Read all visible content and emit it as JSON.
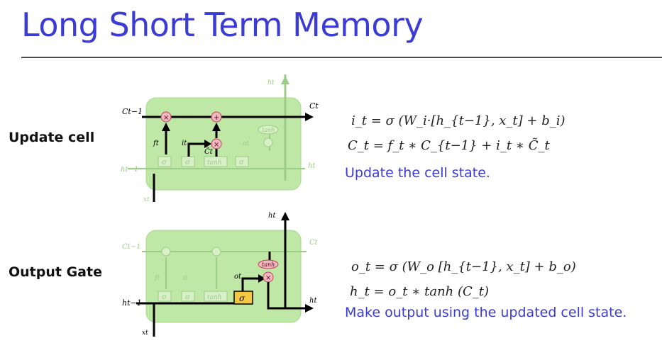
{
  "title": "Long Short Term Memory",
  "sections": [
    {
      "label": "Update cell",
      "equations": [
        "i_t = σ (W_i·[h_{t−1}, x_t] + b_i)",
        "C_t = f_t ∗ C_{t−1} + i_t ∗ C̃_t"
      ],
      "description": "Update the cell state."
    },
    {
      "label": "Output Gate",
      "equations": [
        "o_t = σ (W_o [h_{t−1}, x_t] + b_o)",
        "h_t = o_t ∗ tanh (C_t)"
      ],
      "description": "Make output using the updated cell state."
    }
  ],
  "diagram": {
    "cell_in": "C_{t−1}",
    "cell_out": "C_t",
    "hidden_in": "h_{t−1}",
    "hidden_out": "h_t",
    "input": "x_t",
    "gate_sigma": "σ",
    "gate_tanh": "tanh",
    "op_mult": "×",
    "op_add": "+",
    "forget": "f_t",
    "input_gate": "i_t",
    "candidate": "C̃_t",
    "output_gate": "o_t",
    "colors": {
      "cell_fill": "#bfe8a6",
      "active_line": "#000000",
      "faded_line": "#9ccd86",
      "op_fill": "#f0b8c4",
      "sigma_highlight": "#f5c842"
    }
  }
}
